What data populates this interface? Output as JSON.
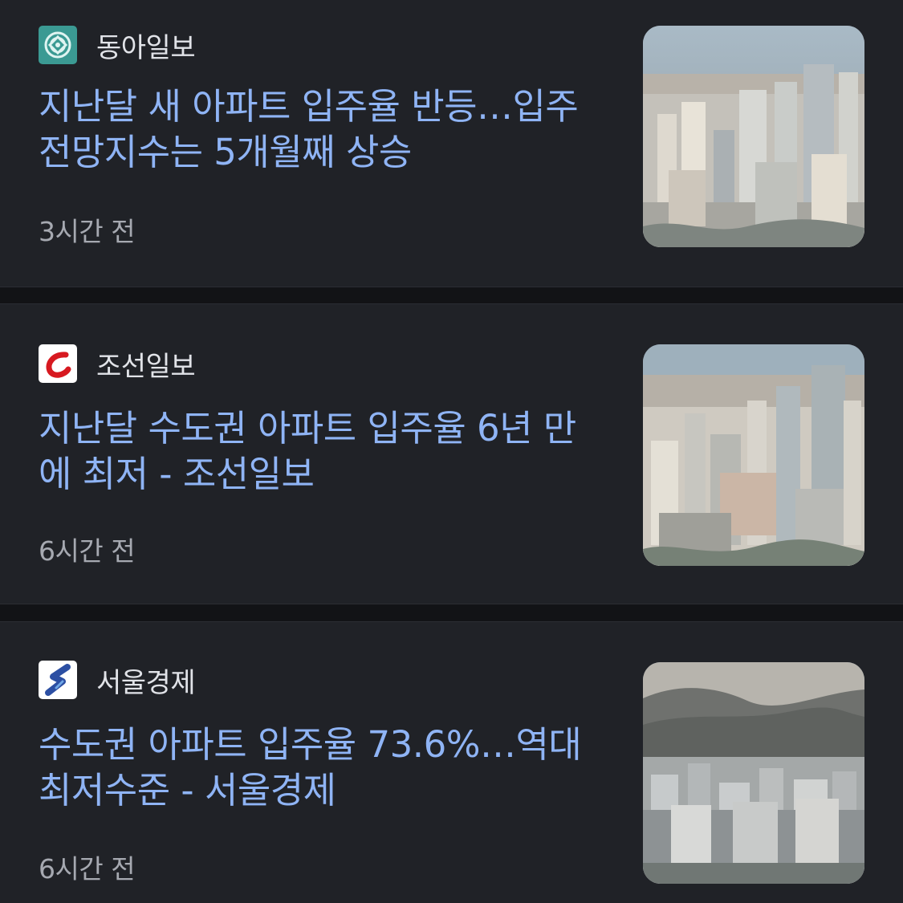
{
  "feed": {
    "articles": [
      {
        "source": "동아일보",
        "source_logo_icon": "donga-logo-icon",
        "headline": "지난달 새 아파트 입주율 반등…입주 전망지수는 5개월째 상승",
        "time": "3시간 전",
        "thumbnail_icon": "city-apartments-thumbnail",
        "accent": "#3b9a93"
      },
      {
        "source": "조선일보",
        "source_logo_icon": "chosun-logo-icon",
        "headline": "지난달 수도권 아파트 입주율 6년 만에 최저 - 조선일보",
        "time": "6시간 전",
        "thumbnail_icon": "city-apartments-thumbnail",
        "accent": "#d71920"
      },
      {
        "source": "서울경제",
        "source_logo_icon": "sedaily-logo-icon",
        "headline": "수도권 아파트 입주율 73.6%…역대 최저수준 - 서울경제",
        "time": "6시간 전",
        "thumbnail_icon": "city-apartments-thumbnail",
        "accent": "#2c4fa3"
      }
    ]
  },
  "colors": {
    "background": "#202227",
    "separator": "#121316",
    "headline": "#8fb4f5",
    "source": "#e1e3e8",
    "timestamp": "#a6a9b1"
  }
}
